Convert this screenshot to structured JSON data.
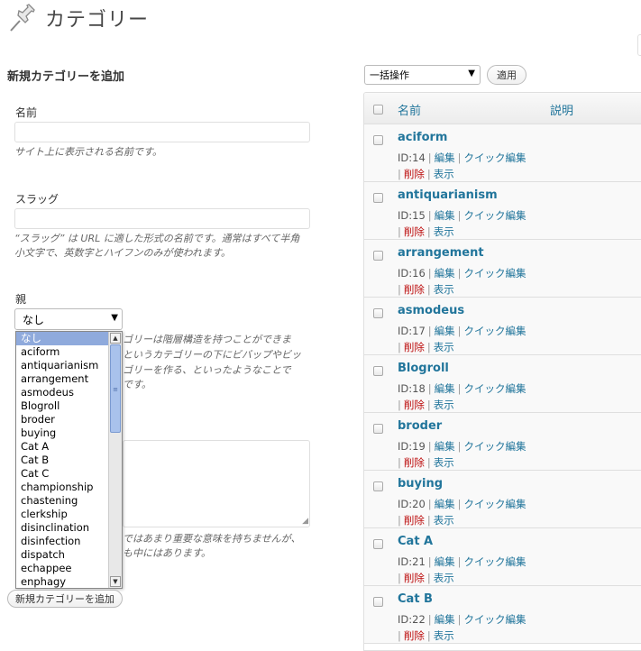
{
  "page_title": "カテゴリー",
  "form": {
    "heading": "新規カテゴリーを追加",
    "name_label": "名前",
    "name_value": "",
    "name_help": "サイト上に表示される名前です。",
    "slug_label": "スラッグ",
    "slug_value": "",
    "slug_help_1": "“スラッグ” は URL に適した形式の名前です。通常はすべて半角",
    "slug_help_2": "小文字で、英数字とハイフンのみが使われます。",
    "parent_label": "親",
    "parent_selected": "なし",
    "parent_help_1": "ゴリーは階層構造を持つことができま",
    "parent_help_2": "というカテゴリーの下にビバップやビッ",
    "parent_help_3": "ゴリーを作る、といったようなことで",
    "parent_help_4": "です。",
    "desc_help_1": "ではあまり重要な意味を持ちませんが、",
    "desc_help_2": "も中にはあります。",
    "add_button": "新規カテゴリーを追加",
    "parent_options": [
      "なし",
      "aciform",
      "antiquarianism",
      "arrangement",
      "asmodeus",
      "Blogroll",
      "broder",
      "buying",
      "Cat A",
      "Cat B",
      "Cat C",
      "championship",
      "chastening",
      "clerkship",
      "disinclination",
      "disinfection",
      "dispatch",
      "echappee",
      "enphagy"
    ]
  },
  "list": {
    "bulk_action": "一括操作",
    "apply_button": "適用",
    "columns": {
      "name": "名前",
      "description": "説明"
    },
    "action_labels": {
      "edit": "編集",
      "quick_edit": "クイック編集",
      "delete": "削除",
      "view": "表示"
    },
    "rows": [
      {
        "name": "aciform",
        "id": "ID:14"
      },
      {
        "name": "antiquarianism",
        "id": "ID:15"
      },
      {
        "name": "arrangement",
        "id": "ID:16"
      },
      {
        "name": "asmodeus",
        "id": "ID:17"
      },
      {
        "name": "Blogroll",
        "id": "ID:18"
      },
      {
        "name": "broder",
        "id": "ID:19"
      },
      {
        "name": "buying",
        "id": "ID:20"
      },
      {
        "name": "Cat A",
        "id": "ID:21"
      },
      {
        "name": "Cat B",
        "id": "ID:22"
      }
    ]
  }
}
